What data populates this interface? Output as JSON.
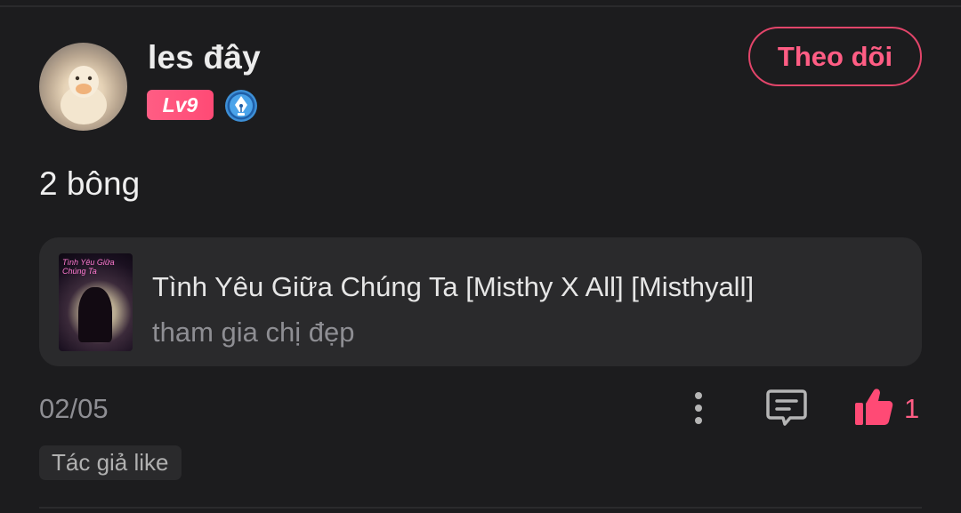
{
  "user": {
    "name": "les đây",
    "level": "Lv9"
  },
  "follow_button": {
    "label": "Theo dõi"
  },
  "post": {
    "text": "2 bông",
    "date": "02/05",
    "like_count": "1",
    "author_like_badge": "Tác giả like"
  },
  "book": {
    "title": "Tình Yêu Giữa Chúng Ta [Misthy X All] [Misthyall]",
    "subtitle": "tham gia chị đẹp",
    "cover_text": "Tình Yêu Giữa Chúng Ta"
  },
  "colors": {
    "accent": "#ff5d84",
    "background": "#1c1c1e",
    "card": "#2a2a2c",
    "muted_text": "#8e8e93"
  },
  "icons": {
    "writer_badge": "pen-nib-icon",
    "more": "more-vertical-icon",
    "comment": "comment-icon",
    "like": "thumbs-up-icon"
  }
}
